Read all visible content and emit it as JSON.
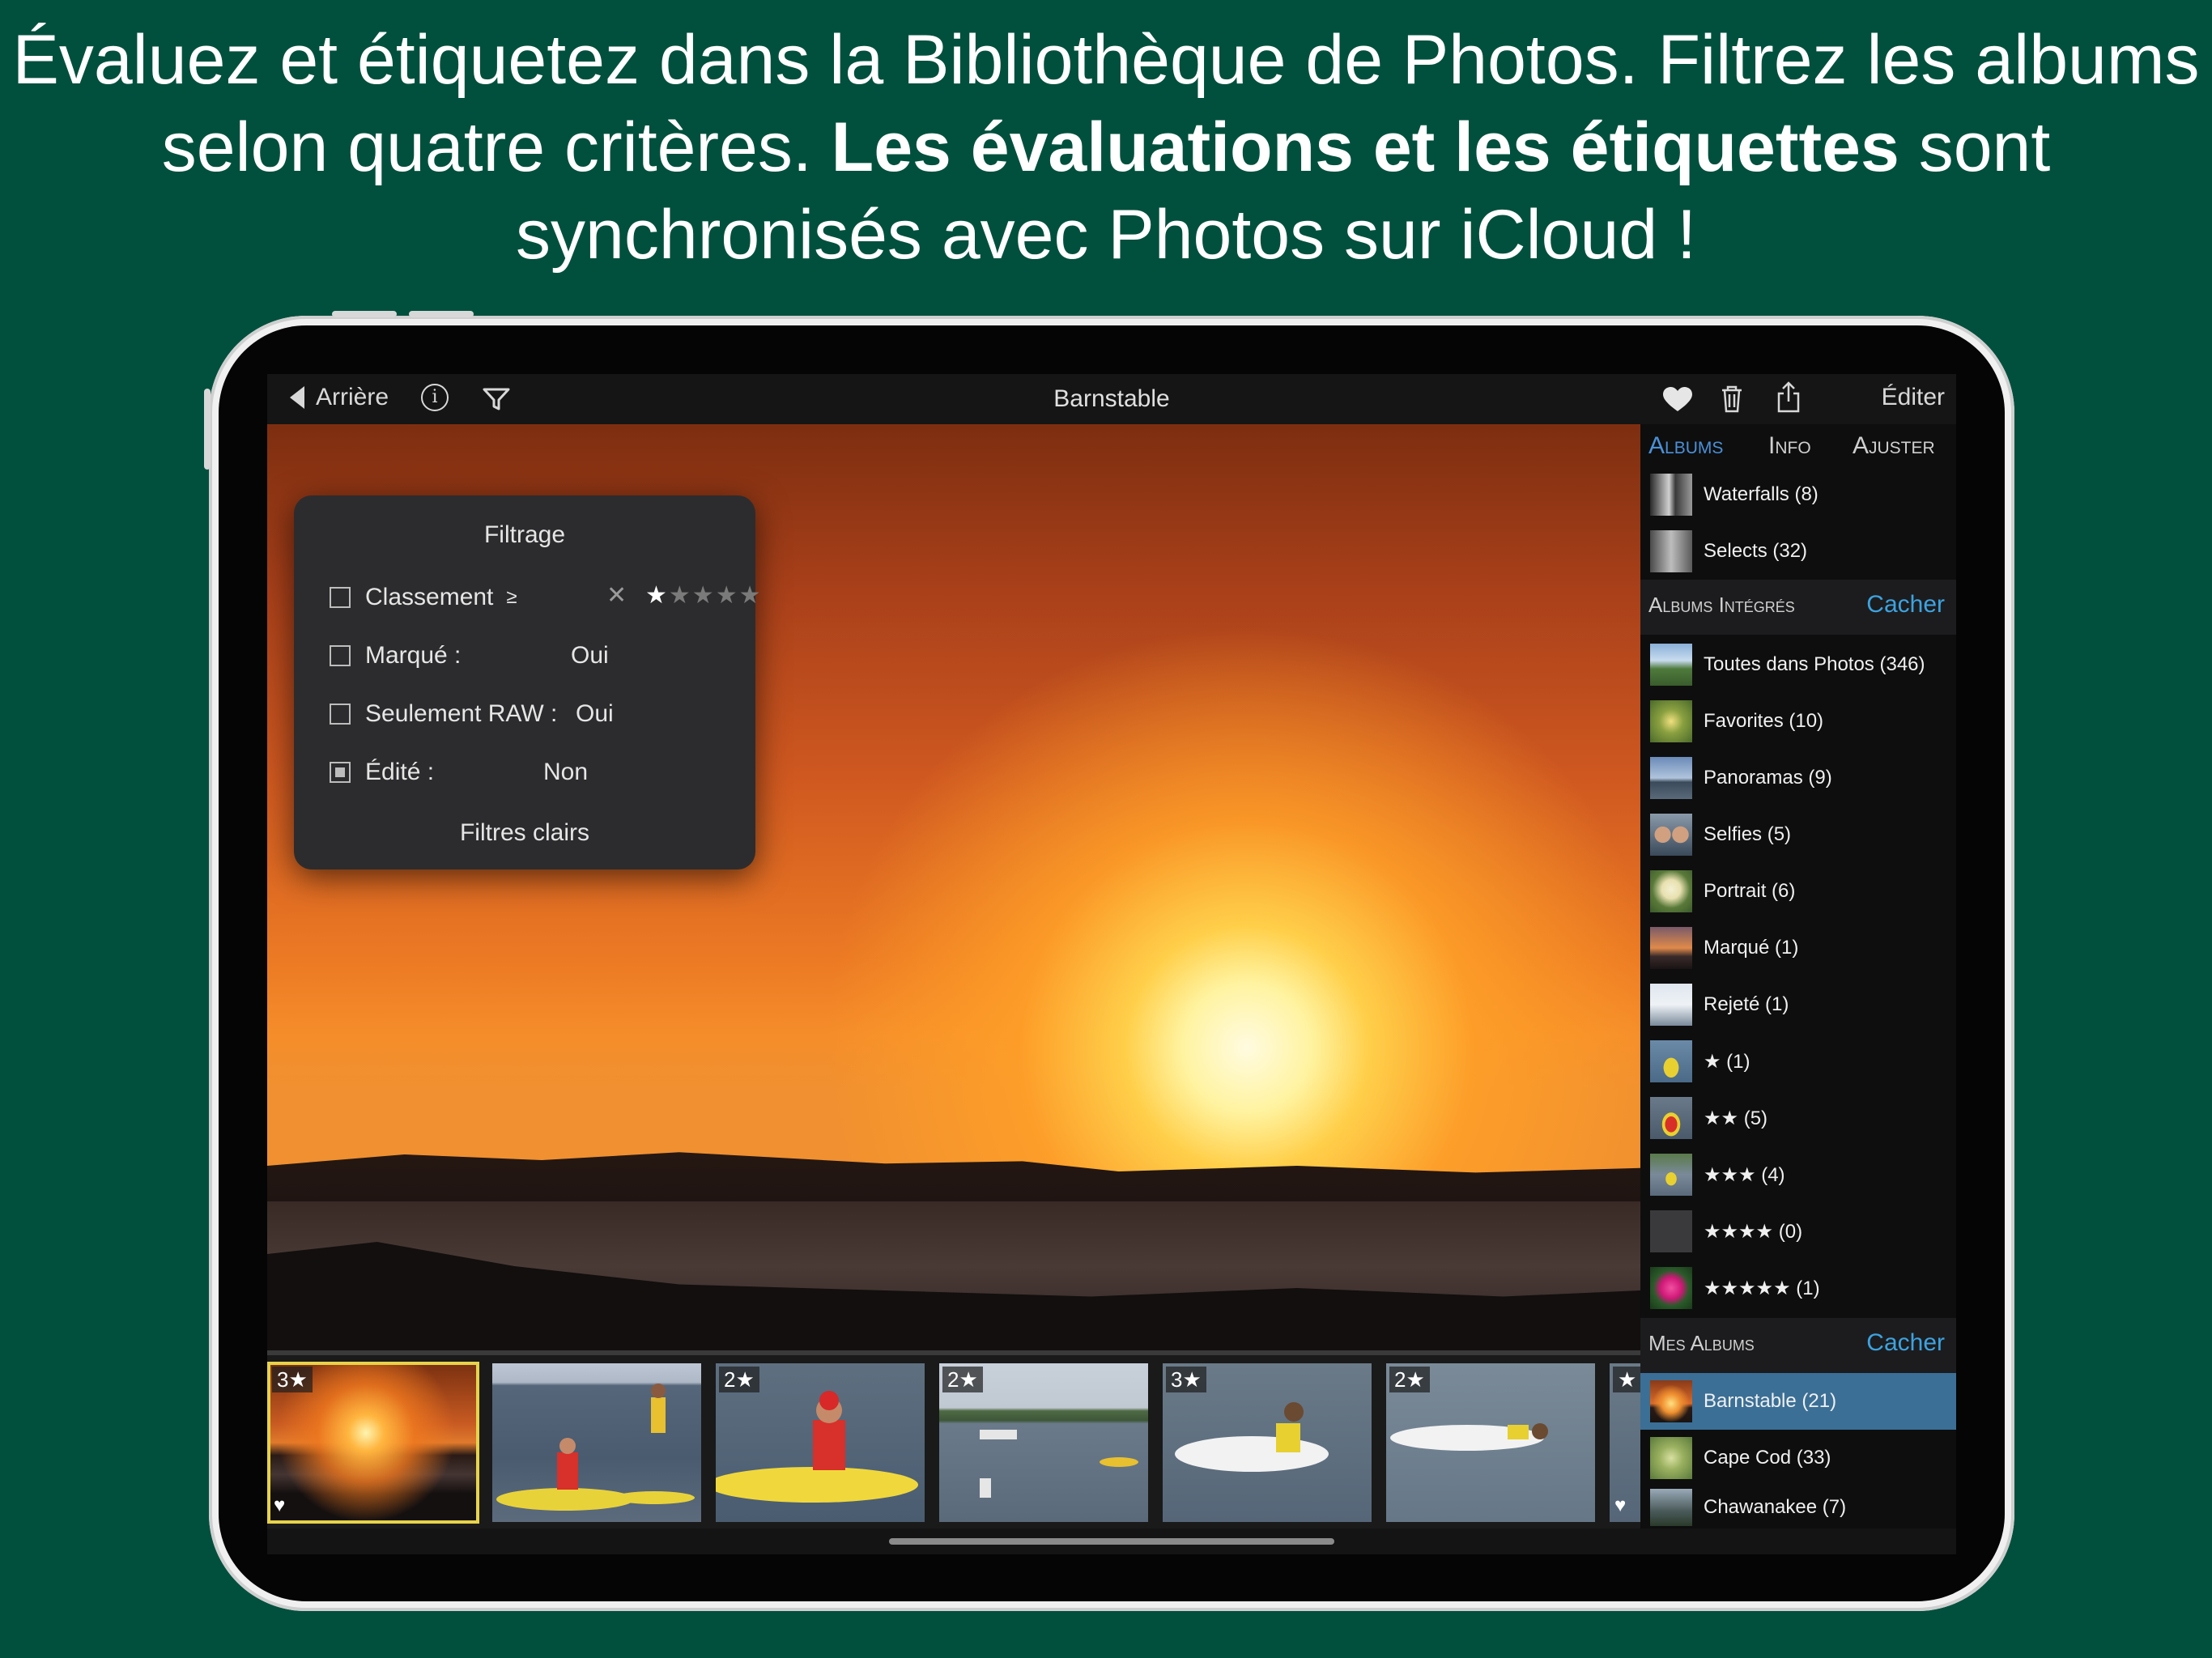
{
  "headline": {
    "line1": "Évaluez et étiquetez dans la Bibliothèque de Photos. Filtrez les albums",
    "line2_pre": "selon quatre critères. ",
    "line2_bold": "Les évaluations et les étiquettes",
    "line2_post": " sont",
    "line3": "synchronisés avec Photos sur iCloud !"
  },
  "toolbar": {
    "back_label": "Arrière",
    "info_glyph": "i",
    "title": "Barnstable",
    "edit_label": "Éditer"
  },
  "filter_popover": {
    "title": "Filtrage",
    "rows": [
      {
        "label": "Classement",
        "op": "≥",
        "clear": "✕",
        "stars_filled": "★",
        "stars_empty": "★★★★",
        "checked": false
      },
      {
        "label": "Marqué :",
        "value": "Oui",
        "checked": false
      },
      {
        "label": "Seulement RAW :",
        "value": "Oui",
        "checked": false
      },
      {
        "label": "Édité :",
        "value": "Non",
        "checked": true
      }
    ],
    "clear_label": "Filtres clairs"
  },
  "filmstrip": [
    {
      "badge": "3★",
      "selected": true,
      "favorite": true
    },
    {
      "badge": "",
      "selected": false,
      "favorite": false
    },
    {
      "badge": "2★",
      "selected": false,
      "favorite": false
    },
    {
      "badge": "2★",
      "selected": false,
      "favorite": false
    },
    {
      "badge": "3★",
      "selected": false,
      "favorite": false
    },
    {
      "badge": "2★",
      "selected": false,
      "favorite": false
    },
    {
      "badge": "★",
      "selected": false,
      "favorite": true
    }
  ],
  "sidebar": {
    "tabs": [
      "Albums",
      "Info",
      "Ajuster"
    ],
    "active_tab": "Albums",
    "top_albums": [
      {
        "label": "Waterfalls (8)"
      },
      {
        "label": "Selects (32)"
      }
    ],
    "integrated_section": {
      "title": "Albums Intégrés",
      "action": "Cacher"
    },
    "integrated_albums": [
      {
        "label": "Toutes dans Photos (346)"
      },
      {
        "label": "Favorites (10)"
      },
      {
        "label": "Panoramas (9)"
      },
      {
        "label": "Selfies (5)"
      },
      {
        "label": "Portrait (6)"
      },
      {
        "label": "Marqué (1)"
      },
      {
        "label": "Rejeté (1)"
      },
      {
        "label": "★ (1)"
      },
      {
        "label": "★★ (5)"
      },
      {
        "label": "★★★ (4)"
      },
      {
        "label": "★★★★ (0)"
      },
      {
        "label": "★★★★★ (1)"
      }
    ],
    "my_section": {
      "title": "Mes Albums",
      "action": "Cacher"
    },
    "my_albums": [
      {
        "label": "Barnstable (21)",
        "selected": true
      },
      {
        "label": "Cape Cod (33)",
        "selected": false
      },
      {
        "label": "Chawanakee (7)",
        "selected": false
      }
    ]
  },
  "colors": {
    "background": "#00503d",
    "accent_blue": "#4a90d9",
    "selection_blue": "#3b6f96",
    "action_blue": "#3da3e0",
    "selection_yellow": "#e6d34a"
  },
  "icons": {
    "back": "back-triangle-icon",
    "info": "info-icon",
    "filter": "funnel-icon",
    "favorite": "heart-icon",
    "delete": "trash-icon",
    "share": "share-icon"
  }
}
